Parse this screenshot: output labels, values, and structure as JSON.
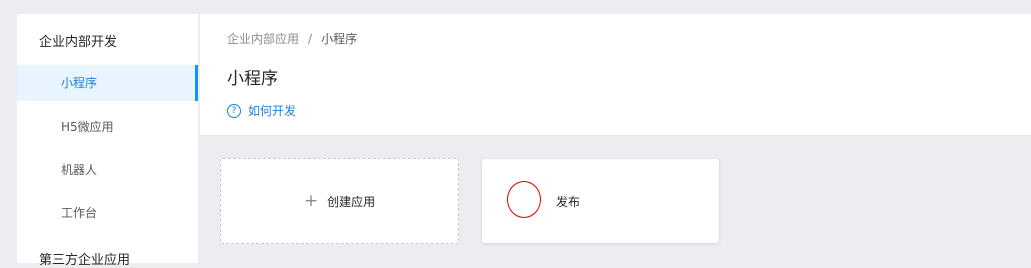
{
  "sidebar": {
    "group1": "企业内部开发",
    "items": [
      "小程序",
      "H5微应用",
      "机器人",
      "工作台"
    ],
    "group2": "第三方企业应用"
  },
  "header": {
    "breadcrumb": [
      "企业内部应用",
      "小程序"
    ],
    "title": "小程序",
    "help_link": "如何开发"
  },
  "cards": {
    "create_label": "创建应用",
    "app_name": "发布"
  },
  "colors": {
    "accent": "#1890ff",
    "active_bg": "#e8f4ff",
    "logo_outline": "#e00000"
  },
  "icons": {
    "help": "question-circle-icon",
    "create": "plus-icon"
  }
}
